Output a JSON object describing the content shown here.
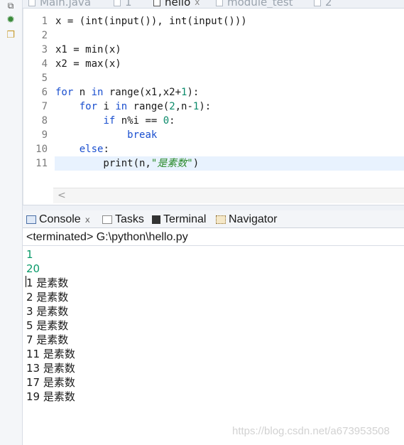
{
  "editor_tabs": [
    {
      "label": "Main.java",
      "active": false,
      "closable": false
    },
    {
      "label": "1",
      "active": false,
      "closable": false
    },
    {
      "label": "hello",
      "active": true,
      "closable": true
    },
    {
      "label": "module_test",
      "active": false,
      "closable": false
    },
    {
      "label": "2",
      "active": false,
      "closable": false
    }
  ],
  "close_glyph": "ⅹ",
  "editor": {
    "line_numbers": [
      "1",
      "2",
      "3",
      "4",
      "5",
      "6",
      "7",
      "8",
      "9",
      "10",
      "11"
    ],
    "current_line": 11,
    "code_lines": [
      "x = (int(input()), int(input()))",
      "",
      "x1 = min(x)",
      "x2 = max(x)",
      "",
      "for n in range(x1,x2+1):",
      "    for i in range(2,n-1):",
      "        if n%i == 0:",
      "            break",
      "    else:",
      "        print(n,\"是素数\")"
    ],
    "scroll_left_arrow": "<"
  },
  "view_tabs": [
    {
      "label": "Console",
      "icon": "console-icon",
      "active": true,
      "closable": true
    },
    {
      "label": "Tasks",
      "icon": "tasks-icon",
      "active": false,
      "closable": false
    },
    {
      "label": "Terminal",
      "icon": "terminal-icon",
      "active": false,
      "closable": false
    },
    {
      "label": "Navigator",
      "icon": "navigator-icon",
      "active": false,
      "closable": false
    }
  ],
  "console": {
    "terminated_text": "<terminated> G:\\python\\hello.py",
    "input_lines": [
      "1",
      "20"
    ],
    "output_lines": [
      "1 是素数",
      "2 是素数",
      "3 是素数",
      "5 是素数",
      "7 是素数",
      "11 是素数",
      "13 是素数",
      "17 是素数",
      "19 是素数"
    ]
  },
  "watermark": "https://blog.csdn.net/a673953508",
  "colors": {
    "keyword": "#1a4fcf",
    "number": "#0a8a6a",
    "string": "#2a8a2a",
    "console_input": "#0a9a6a",
    "current_line_bg": "#e8f2fe"
  }
}
